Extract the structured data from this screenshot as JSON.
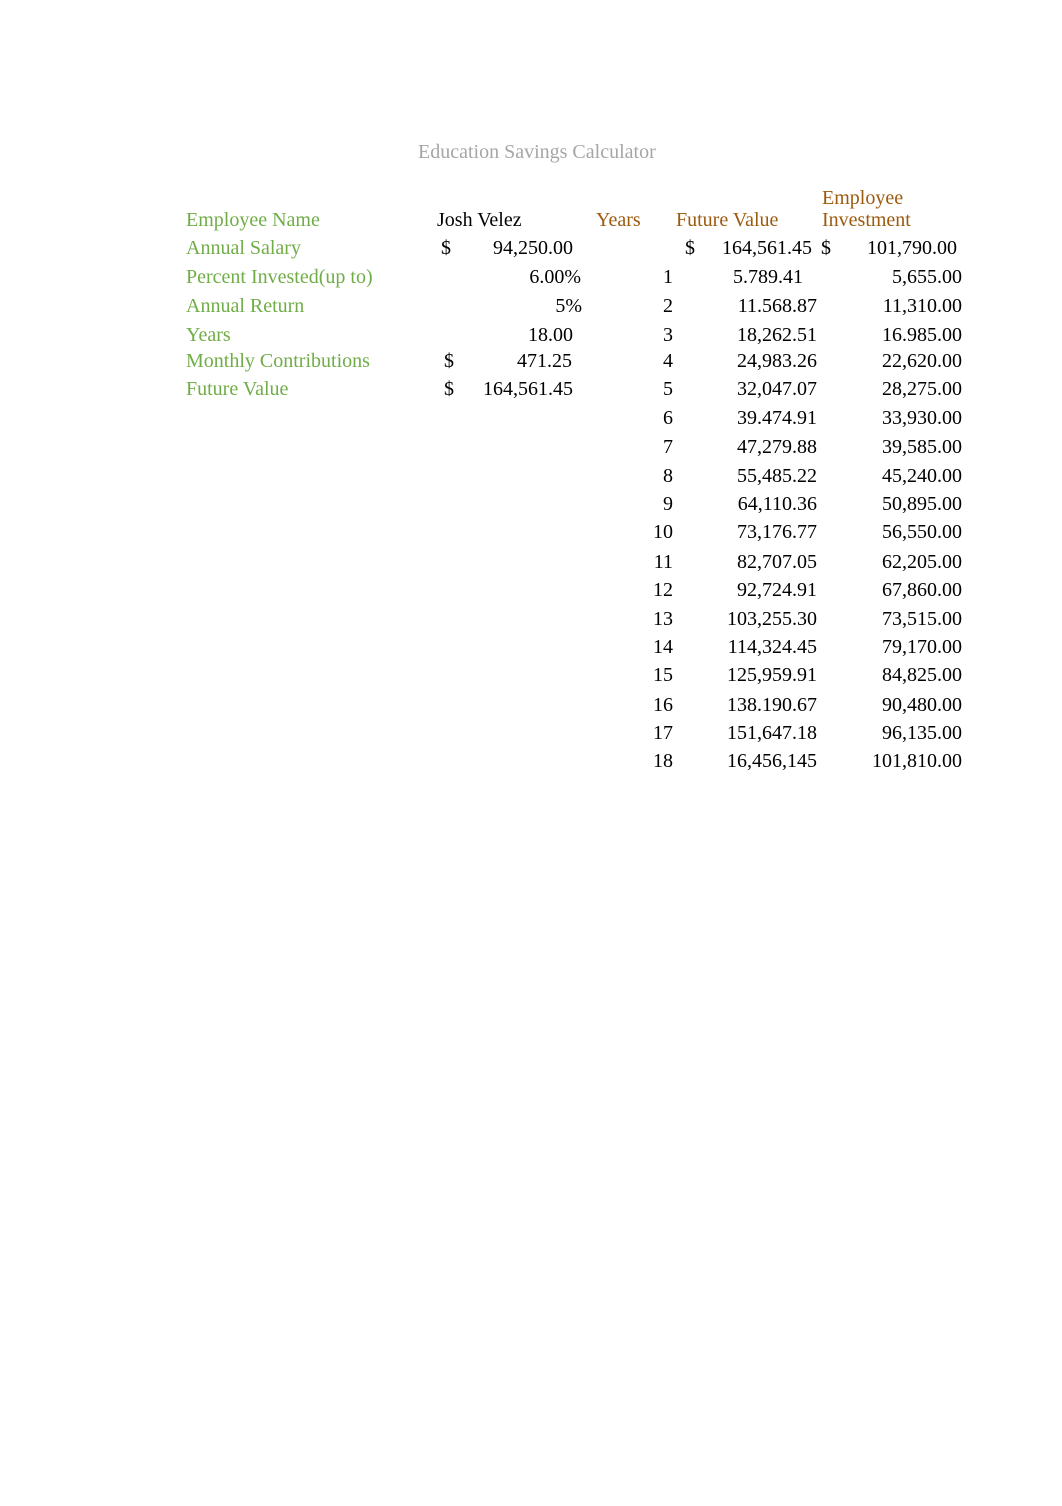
{
  "title": "Education Savings Calculator",
  "colors": {
    "title": "#a6a6a6",
    "label": "#70ad47",
    "header": "#9c5a0e",
    "value": "#000000"
  },
  "inputs": {
    "employee_name": {
      "label": "Employee Name",
      "value": "Josh Velez"
    },
    "annual_salary": {
      "label": "Annual Salary",
      "currency": "$",
      "value": "94,250.00"
    },
    "percent_invested": {
      "label": "Percent Invested(up to)",
      "value": "6.00%"
    },
    "annual_return": {
      "label": "Annual Return",
      "value": "5%"
    },
    "years": {
      "label": "Years",
      "value": "18.00"
    },
    "monthly_contributions": {
      "label": "Monthly Contributions",
      "currency": "$",
      "value": "471.25"
    },
    "future_value": {
      "label": "Future Value",
      "currency": "$",
      "value": "164,561.45"
    }
  },
  "schedule": {
    "headers": {
      "years": "Years",
      "future_value": "Future Value",
      "employee_investment_line1": "Employee",
      "employee_investment_line2": "Investment"
    },
    "totals": {
      "future_value_currency": "$",
      "future_value": "164,561.45",
      "employee_investment_currency": "$",
      "employee_investment": "101,790.00"
    },
    "rows": [
      {
        "year": "1",
        "future_value": "5.789.41",
        "employee_investment": "5,655.00"
      },
      {
        "year": "2",
        "future_value": "11.568.87",
        "employee_investment": "11,310.00"
      },
      {
        "year": "3",
        "future_value": "18,262.51",
        "employee_investment": "16.985.00"
      },
      {
        "year": "4",
        "future_value": "24,983.26",
        "employee_investment": "22,620.00"
      },
      {
        "year": "5",
        "future_value": "32,047.07",
        "employee_investment": "28,275.00"
      },
      {
        "year": "6",
        "future_value": "39.474.91",
        "employee_investment": "33,930.00"
      },
      {
        "year": "7",
        "future_value": "47,279.88",
        "employee_investment": "39,585.00"
      },
      {
        "year": "8",
        "future_value": "55,485.22",
        "employee_investment": "45,240.00"
      },
      {
        "year": "9",
        "future_value": "64,110.36",
        "employee_investment": "50,895.00"
      },
      {
        "year": "10",
        "future_value": "73,176.77",
        "employee_investment": "56,550.00"
      },
      {
        "year": "11",
        "future_value": "82,707.05",
        "employee_investment": "62,205.00"
      },
      {
        "year": "12",
        "future_value": "92,724.91",
        "employee_investment": "67,860.00"
      },
      {
        "year": "13",
        "future_value": "103,255.30",
        "employee_investment": "73,515.00"
      },
      {
        "year": "14",
        "future_value": "114,324.45",
        "employee_investment": "79,170.00"
      },
      {
        "year": "15",
        "future_value": "125,959.91",
        "employee_investment": "84,825.00"
      },
      {
        "year": "16",
        "future_value": "138.190.67",
        "employee_investment": "90,480.00"
      },
      {
        "year": "17",
        "future_value": "151,647.18",
        "employee_investment": "96,135.00"
      },
      {
        "year": "18",
        "future_value": "16,456,145",
        "employee_investment": "101,810.00"
      }
    ]
  }
}
